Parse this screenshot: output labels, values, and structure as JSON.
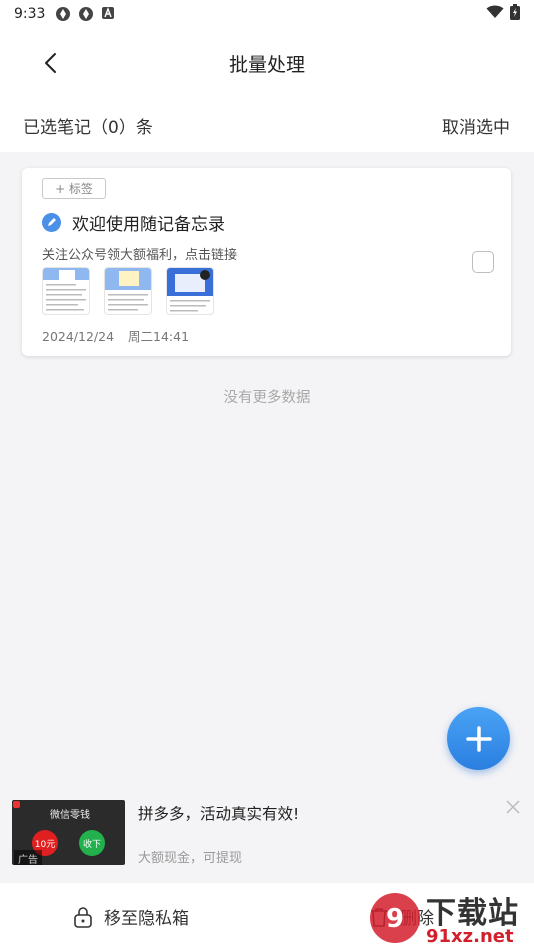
{
  "status_bar": {
    "time": "9:33"
  },
  "header": {
    "title": "批量处理"
  },
  "selection": {
    "count_label": "已选笔记（0）条",
    "deselect_label": "取消选中"
  },
  "note": {
    "tag_label": "+ 标签",
    "title": "欢迎使用随记备忘录",
    "preview": "关注公众号领大额福利，点击链接",
    "date": "2024/12/24",
    "time": "周二14:41"
  },
  "list_end_text": "没有更多数据",
  "ad": {
    "image_top_text": "微信零钱",
    "image_red_text": "10元",
    "image_green_text": "收下",
    "ad_tag": "广告",
    "title": "拼多多，活动真实有效!",
    "subtitle": "大额现金，可提现"
  },
  "bottom_bar": {
    "move_label": "移至隐私箱",
    "delete_label": "删除"
  },
  "watermark": {
    "line1": "下载站",
    "line2": "91xz.net"
  },
  "colors": {
    "accent": "#2a7fe0",
    "background": "#f4f4f6",
    "watermark_red": "#d21f2b"
  }
}
